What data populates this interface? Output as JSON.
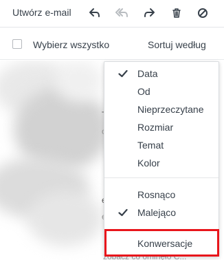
{
  "toolbar": {
    "compose_label": "Utwórz e-mail",
    "icons": [
      "reply-icon",
      "reply-all-icon",
      "forward-icon",
      "trash-icon",
      "block-icon"
    ]
  },
  "list_header": {
    "select_all_label": "Wybierz wszystko",
    "sort_label": "Sortuj według"
  },
  "sort_menu": {
    "fields": [
      {
        "label": "Data",
        "checked": true
      },
      {
        "label": "Od",
        "checked": false
      },
      {
        "label": "Nieprzeczytane",
        "checked": false
      },
      {
        "label": "Rozmiar",
        "checked": false
      },
      {
        "label": "Temat",
        "checked": false
      },
      {
        "label": "Kolor",
        "checked": false
      }
    ],
    "order": [
      {
        "label": "Rosnąco",
        "checked": false
      },
      {
        "label": "Malejąco",
        "checked": true
      }
    ],
    "conversations_label": "Konwersacje"
  },
  "background": {
    "fragments": [
      "T",
      "o",
      "e",
      "e"
    ],
    "bottom_snippet": "zobacz co ominęło C..."
  },
  "colors": {
    "highlight_border": "#e8151b",
    "text": "#37404a"
  }
}
